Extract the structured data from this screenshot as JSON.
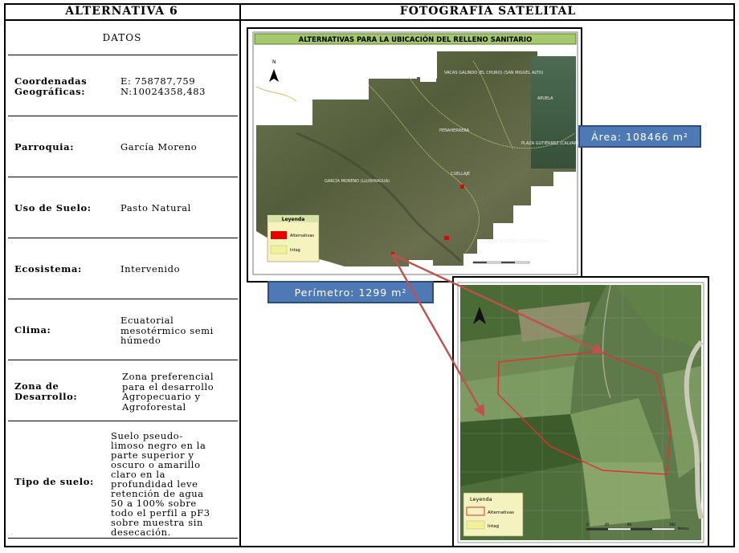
{
  "header": {
    "left_title": "ALTERNATIVA 6",
    "right_title": "FOTOGRAFÍA SATELITAL"
  },
  "datos_title": "DATOS",
  "rows": {
    "coordenadas": {
      "label_line1": "Coordenadas",
      "label_line2": "Geográficas:",
      "value_line1": "E: 758787,759",
      "value_line2": "N:10024358,483"
    },
    "parroquia": {
      "label": "Parroquia:",
      "value": "García Moreno"
    },
    "uso_suelo": {
      "label": "Uso de Suelo:",
      "value": "Pasto Natural"
    },
    "ecosistema": {
      "label": "Ecosistema:",
      "value": "Intervenido"
    },
    "clima": {
      "label": "Clima:",
      "value_lines": [
        "Ecuatorial",
        "mesotérmico semi",
        "húmedo"
      ]
    },
    "zona": {
      "label_line1": "Zona de",
      "label_line2": "Desarrollo:",
      "value_lines": [
        "Zona preferencial",
        "para el desarrollo",
        "Agropecuario y",
        "Agroforestal"
      ]
    },
    "tipo_suelo": {
      "label": "Tipo de suelo:",
      "value_lines": [
        "Suelo pseudo-",
        "limoso negro en la",
        "parte superior y",
        "oscuro o amarillo",
        "claro en la",
        "profundidad leve",
        "retención de agua",
        "50 a 100% sobre",
        "todo el perfil a pF3",
        "sobre muestra sin",
        "desecación."
      ]
    }
  },
  "map_main": {
    "title": "ALTERNATIVAS PARA LA UBICACIÓN DEL RELLENO SANITARIO",
    "north": "N",
    "place_labels": [
      "GARCÍA MORENO (LLURIMAGUA)",
      "CUELLAJE",
      "PLAZA GUTIÉRREZ (CALVARIO)",
      "APUELA",
      "VACAS GALINDO (EL CHURO) (SAN MIGUEL ALTO)",
      "PEÑAHERRERA",
      "GARCÍA MORENO (LLURIMAGUA)"
    ],
    "legend": {
      "title": "Leyenda",
      "items": [
        "Alternativas",
        "Intag"
      ]
    }
  },
  "map_zoom": {
    "legend": {
      "title": "Leyenda",
      "items": [
        "Alternativas",
        "Intag"
      ]
    },
    "scale_label": "Metros",
    "scale_ticks": [
      "0",
      "20",
      "40",
      "80",
      "120",
      "160"
    ]
  },
  "callouts": {
    "area": "Área: 108466 m²",
    "perimetro": "Perímetro: 1299 m²"
  },
  "colors": {
    "callout_fill": "#4f79b4",
    "arrow": "#c0504d",
    "map_title_bg": "#a6c86c",
    "alternativa_red": "#e60000",
    "polygon": "#e03030"
  }
}
